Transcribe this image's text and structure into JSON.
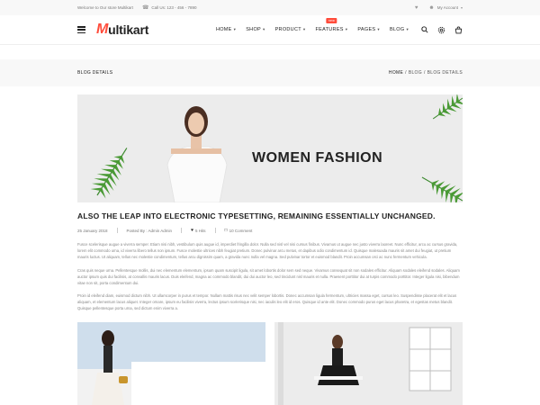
{
  "topbar": {
    "welcome": "Welcome to Our store Multikart",
    "phone": "Call Us: 123 - 456 - 7890",
    "account": "My Account"
  },
  "header": {
    "logo_first": "M",
    "logo_rest": "ultikart",
    "nav": [
      {
        "label": "HOME"
      },
      {
        "label": "SHOP"
      },
      {
        "label": "PRODUCT"
      },
      {
        "label": "FEATURES",
        "badge": "new"
      },
      {
        "label": "PAGES"
      },
      {
        "label": "BLOG"
      }
    ]
  },
  "breadcrumb": {
    "page_title": "BLOG DETAILS",
    "trail": [
      "HOME",
      "/",
      "BLOG",
      "/",
      "BLOG DETAILS"
    ]
  },
  "banner": {
    "title": "WOMEN FASHION"
  },
  "post": {
    "title": "ALSO THE LEAP INTO ELECTRONIC TYPESETTING, REMAINING ESSENTIALLY UNCHANGED.",
    "date": "25 January 2018",
    "author": "Posted By : Admin Admin",
    "hits": "5 Hits",
    "comments": "10 Comment",
    "paragraphs": [
      "Fusce scelerisque augue a viverra semper. Etiam nisi nibh, vestibulum quis augue id, imperdiet fringilla dolor. Nulla sed nisl vel nisi cursus finibus. Vivamus ut augue nec justo viverra laoreet. Nunc efficitur, arcu ac cursus gravida, lorem elit commodo urna, id viverra libero tellus non ipsum. Fusce molestie ultrices nibh feugiat pretium. Donec pulvinar arcu metus, et dapibus odio condimentum id. Quisque malesuada mauris sit amet dui feugiat, ut pretium mauris luctus. Ut aliquam, tellus nec molestie condimentum, tellus arcu dignissim quam, a gravida nunc nulla vel magna. Sed pulvinar tortor et euismod blandit. Proin accumsan orci ac nunc fermentum vehicula.",
      "Cras quis neque urna. Pellentesque mollis, dui nec elementum elementum, ipsum quam suscipit ligula, sit amet lobortis dolor sem sed neque. Vivamus consequat sit non sodales efficitur. Aliquam sodales eleifend sodales. Aliquam auctor ipsum quis dui facilisis, at convallis mauris lacus. Duis eleifend, magna ac commodo blandit, dui dui auctor leo, sed tincidunt nisl mauris et nulla. Praesent porttitor dui at turpis commodo porttitor. Integer ligula nisi, bibendum vitae non sit, porta condimentum dui.",
      "Proin id eleifend diam, euismod dictum nibh. Ut ullamcorper in purus et tempor. Nullam mattis risus nec velit semper lobortis. Donec accumsan ligula fermentum, ultricies massa eget, cursus leo. Suspendisse placerat elit et lacus aliquam, et elementum lacus aliquet. Integer ornare, ipsum eu facilisis viverra, lectus ipsum scelerisque nisi, nec iaculis leo elit id eros. Quisque id ante elit. Donec commodo purus eget lacus pharetra, et egestas metus blandit. Quisque pellentesque porta urna, sed dictum enim viverra a."
    ]
  },
  "colors": {
    "accent": "#ff4c3b",
    "topbar_bg": "#f8f8f8",
    "banner_bg": "#ececec",
    "leaf_green": "#3d8a2f"
  }
}
